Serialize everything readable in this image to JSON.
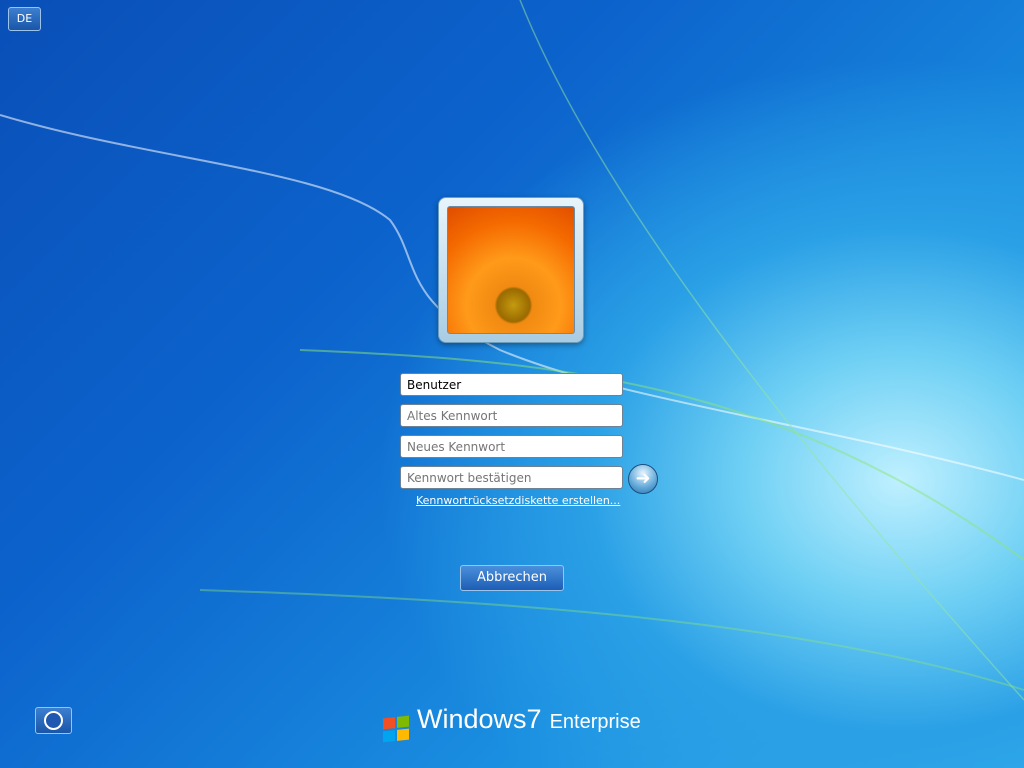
{
  "language": "DE",
  "fields": {
    "user": "Benutzer",
    "old_password": "Altes Kennwort",
    "new_password": "Neues Kennwort",
    "confirm_password": "Kennwort bestätigen"
  },
  "reset_link": "Kennwortrücksetzdiskette erstellen...",
  "cancel_label": "Abbrechen",
  "brand": {
    "name": "Windows",
    "version": "7",
    "edition": "Enterprise"
  },
  "flag_colors": [
    "#f25022",
    "#7fba00",
    "#00a4ef",
    "#ffb900"
  ]
}
